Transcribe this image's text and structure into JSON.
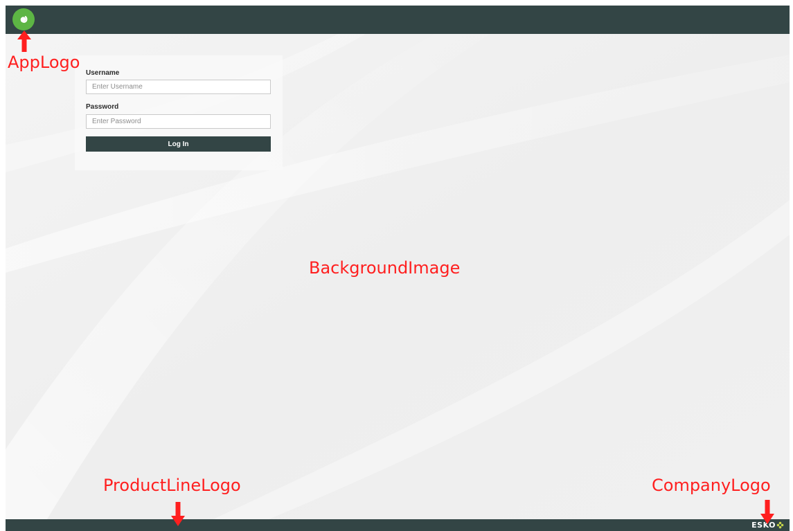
{
  "login": {
    "username_label": "Username",
    "username_placeholder": "Enter Username",
    "password_label": "Password",
    "password_placeholder": "Enter Password",
    "login_button": "Log In"
  },
  "footer": {
    "company_logo_text": "ESKO"
  },
  "annotations": {
    "app_logo": "AppLogo",
    "background_image": "BackgroundImage",
    "product_line_logo": "ProductLineLogo",
    "company_logo": "CompanyLogo"
  },
  "colors": {
    "bar": "#334545",
    "app_logo": "#5db544",
    "annotation": "#ff1f1f",
    "company_logo_accent": "#c7d54a"
  },
  "icons": {
    "app_logo": "spiral-icon",
    "company_logo_mark": "flower-icon",
    "annotation_arrow": "arrow-icon"
  }
}
